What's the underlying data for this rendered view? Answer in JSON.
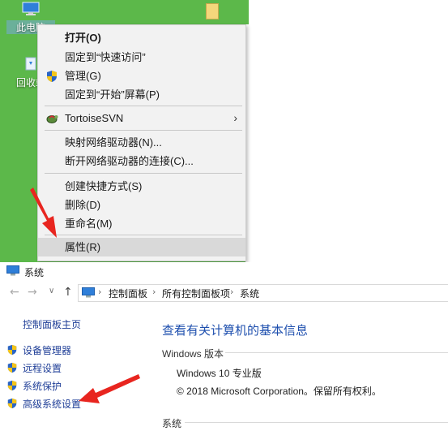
{
  "desktop": {
    "this_pc_label": "此电脑",
    "recycle_bin_label": "回收站"
  },
  "context_menu": {
    "items": [
      {
        "label": "打开(O)"
      },
      {
        "label": "固定到“快速访问”"
      },
      {
        "label": "管理(G)"
      },
      {
        "label": "固定到“开始”屏幕(P)"
      },
      {
        "label": "TortoiseSVN"
      },
      {
        "label": "映射网络驱动器(N)..."
      },
      {
        "label": "断开网络驱动器的连接(C)..."
      },
      {
        "label": "创建快捷方式(S)"
      },
      {
        "label": "删除(D)"
      },
      {
        "label": "重命名(M)"
      },
      {
        "label": "属性(R)"
      }
    ],
    "submenu_arrow": "›"
  },
  "system_window": {
    "title": "系统",
    "nav": {
      "back": "←",
      "forward": "→",
      "dropdown": "∨",
      "up": "↑"
    },
    "breadcrumb": {
      "separator": "›",
      "items": [
        "控制面板",
        "所有控制面板项",
        "系统"
      ]
    },
    "left_panel": {
      "home_link": "控制面板主页",
      "links": [
        {
          "label": "设备管理器"
        },
        {
          "label": "远程设置"
        },
        {
          "label": "系统保护"
        },
        {
          "label": "高级系统设置"
        }
      ]
    },
    "main": {
      "heading": "查看有关计算机的基本信息",
      "windows_edition_label": "Windows 版本",
      "edition": "Windows 10 专业版",
      "copyright": "© 2018 Microsoft Corporation。保留所有权利。",
      "system_label": "系统"
    }
  },
  "colors": {
    "desktop_green": "#5cb84a",
    "link_blue": "#1f3e97",
    "heading_blue": "#1e4fae",
    "arrow_red": "#e8251f",
    "menu_highlight": "#d9d9d9"
  }
}
